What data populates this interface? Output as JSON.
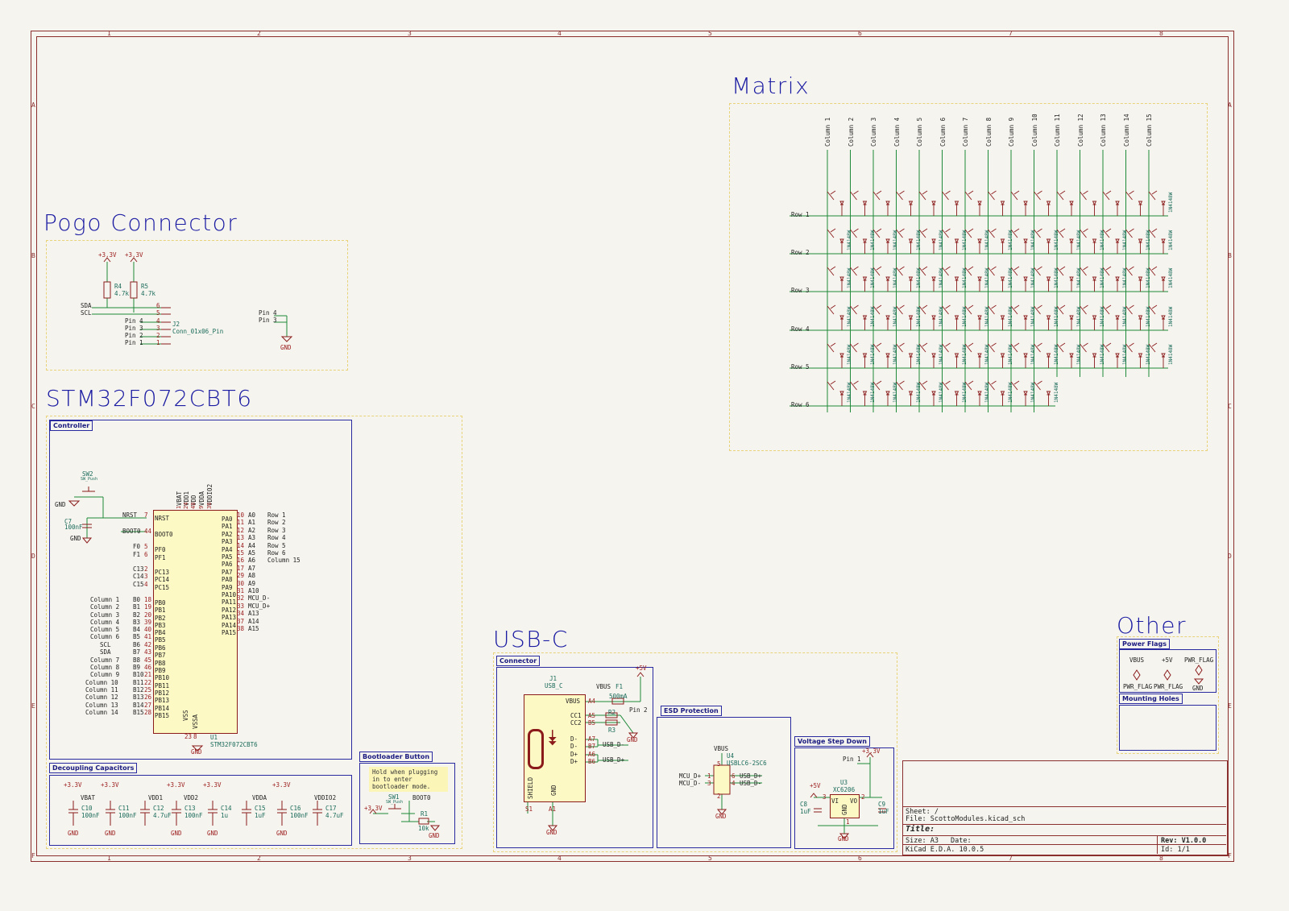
{
  "frame": {
    "zone_numbers": [
      "1",
      "2",
      "3",
      "4",
      "5",
      "6",
      "7",
      "8"
    ],
    "zone_letters": [
      "A",
      "B",
      "C",
      "D",
      "E",
      "F"
    ]
  },
  "sections": {
    "pogo": "Pogo Connector",
    "mcu": "STM32F072CBT6",
    "matrix": "Matrix",
    "usb": "USB-C",
    "other": "Other"
  },
  "boxes": {
    "controller": "Controller",
    "decoupling": "Decoupling Capacitors",
    "bootloader": "Bootloader Button",
    "connector": "Connector",
    "esd": "ESD Protection",
    "vreg": "Voltage Step Down",
    "power_flags": "Power Flags",
    "mounting_holes": "Mounting Holes"
  },
  "pogo": {
    "power1": "+3.3V",
    "power2": "+3.3V",
    "r4_ref": "R4",
    "r4_val": "4.7k",
    "r5_ref": "R5",
    "r5_val": "4.7k",
    "sda": "SDA",
    "scl": "SCL",
    "pins_left": [
      "Pin 4",
      "Pin 3",
      "Pin 2",
      "Pin 1"
    ],
    "pin_nums": [
      "6",
      "5",
      "4",
      "3",
      "2",
      "1"
    ],
    "j2_ref": "J2",
    "j2_val": "Conn_01x06_Pin",
    "pin4": "Pin 4",
    "pin3": "Pin 3",
    "gnd": "GND"
  },
  "mcu": {
    "sw2_ref": "SW2",
    "sw2_val": "SW_Push",
    "gnd1": "GND",
    "gnd2": "GND",
    "gnd3": "GND",
    "c7_ref": "C7",
    "c7_val": "100nF",
    "nrst": "NRST",
    "boot0": "BOOT0",
    "top_pins": [
      "VBAT",
      "VDD1",
      "VDD",
      "VDDA",
      "VDDIO2"
    ],
    "top_nums": [
      "1",
      "24",
      "48",
      "9",
      "36"
    ],
    "left_labels": [
      {
        "net": "NRST",
        "num": "7",
        "pin": "NRST"
      },
      {
        "net": "BOOT0",
        "num": "44",
        "pin": "BOOT0"
      },
      {
        "net": "F0",
        "num": "5",
        "pin": "PF0"
      },
      {
        "net": "F1",
        "num": "6",
        "pin": "PF1"
      },
      {
        "net": "C13",
        "num": "2",
        "pin": "PC13"
      },
      {
        "net": "C14",
        "num": "3",
        "pin": "PC14"
      },
      {
        "net": "C15",
        "num": "4",
        "pin": "PC15"
      },
      {
        "net": "B0",
        "num": "18",
        "pin": "PB0",
        "ext": "Column 1"
      },
      {
        "net": "B1",
        "num": "19",
        "pin": "PB1",
        "ext": "Column 2"
      },
      {
        "net": "B2",
        "num": "20",
        "pin": "PB2",
        "ext": "Column 3"
      },
      {
        "net": "B3",
        "num": "39",
        "pin": "PB3",
        "ext": "Column 4"
      },
      {
        "net": "B4",
        "num": "40",
        "pin": "PB4",
        "ext": "Column 5"
      },
      {
        "net": "B5",
        "num": "41",
        "pin": "PB5",
        "ext": "Column 6"
      },
      {
        "net": "B6",
        "num": "42",
        "pin": "PB6",
        "ext": "SCL"
      },
      {
        "net": "B7",
        "num": "43",
        "pin": "PB7",
        "ext": "SDA"
      },
      {
        "net": "B8",
        "num": "45",
        "pin": "PB8",
        "ext": "Column 7"
      },
      {
        "net": "B9",
        "num": "46",
        "pin": "PB9",
        "ext": "Column 8"
      },
      {
        "net": "B10",
        "num": "21",
        "pin": "PB10",
        "ext": "Column 9"
      },
      {
        "net": "B11",
        "num": "22",
        "pin": "PB11",
        "ext": "Column 10"
      },
      {
        "net": "B12",
        "num": "25",
        "pin": "PB12",
        "ext": "Column 11"
      },
      {
        "net": "B13",
        "num": "26",
        "pin": "PB13",
        "ext": "Column 12"
      },
      {
        "net": "B14",
        "num": "27",
        "pin": "PB14",
        "ext": "Column 13"
      },
      {
        "net": "B15",
        "num": "28",
        "pin": "PB15",
        "ext": "Column 14"
      }
    ],
    "right_labels": [
      {
        "pin": "PA0",
        "num": "10",
        "net": "A0",
        "ext": "Row 1"
      },
      {
        "pin": "PA1",
        "num": "11",
        "net": "A1",
        "ext": "Row 2"
      },
      {
        "pin": "PA2",
        "num": "12",
        "net": "A2",
        "ext": "Row 3"
      },
      {
        "pin": "PA3",
        "num": "13",
        "net": "A3",
        "ext": "Row 4"
      },
      {
        "pin": "PA4",
        "num": "14",
        "net": "A4",
        "ext": "Row 5"
      },
      {
        "pin": "PA5",
        "num": "15",
        "net": "A5",
        "ext": "Row 6"
      },
      {
        "pin": "PA6",
        "num": "16",
        "net": "A6",
        "ext": "Column 15"
      },
      {
        "pin": "PA7",
        "num": "17",
        "net": "A7",
        "ext": ""
      },
      {
        "pin": "PA8",
        "num": "29",
        "net": "A8",
        "ext": ""
      },
      {
        "pin": "PA9",
        "num": "30",
        "net": "A9",
        "ext": ""
      },
      {
        "pin": "PA10",
        "num": "31",
        "net": "A10",
        "ext": ""
      },
      {
        "pin": "PA11",
        "num": "32",
        "net": "MCU_D-",
        "ext": ""
      },
      {
        "pin": "PA12",
        "num": "33",
        "net": "MCU_D+",
        "ext": ""
      },
      {
        "pin": "PA13",
        "num": "34",
        "net": "A13",
        "ext": ""
      },
      {
        "pin": "PA14",
        "num": "37",
        "net": "A14",
        "ext": ""
      },
      {
        "pin": "PA15",
        "num": "38",
        "net": "A15",
        "ext": ""
      }
    ],
    "bottom_pins": [
      "VSS",
      "VSSA"
    ],
    "bottom_nums": [
      "23",
      "8"
    ],
    "u1_ref": "U1",
    "u1_val": "STM32F072CBT6"
  },
  "decoupling": {
    "rails": [
      "+3.3V",
      "+3.3V",
      "+3.3V",
      "+3.3V",
      "+3.3V"
    ],
    "nets": [
      "VBAT",
      "VDD1",
      "VDD2",
      "VDDA",
      "VDDIO2"
    ],
    "caps": [
      {
        "ref": "C10",
        "val": "100nF"
      },
      {
        "ref": "C11",
        "val": "100nF"
      },
      {
        "ref": "C12",
        "val": "4.7uF"
      },
      {
        "ref": "C13",
        "val": "100nF"
      },
      {
        "ref": "C14",
        "val": "1u"
      },
      {
        "ref": "C15",
        "val": "1uF"
      },
      {
        "ref": "C16",
        "val": "100nF"
      },
      {
        "ref": "C17",
        "val": "4.7uF"
      }
    ],
    "gnd": "GND"
  },
  "bootloader": {
    "note": "Hold when plugging in to enter bootloader mode.",
    "rail": "+3.3V",
    "sw1_ref": "SW1",
    "sw1_val": "SW_Push",
    "boot0": "BOOT0",
    "r1_ref": "R1",
    "r1_val": "10k",
    "gnd": "GND"
  },
  "usb": {
    "j1_ref": "J1",
    "j1_val": "USB_C",
    "vbus": "VBUS",
    "f1": "F1",
    "f1_val": "500mA",
    "plus5": "+5V",
    "pin2": "Pin 2",
    "pins": [
      "VBUS",
      "CC1",
      "CC2",
      "D-",
      "D-",
      "D+",
      "D+"
    ],
    "pin_nums": [
      "A4",
      "A5",
      "B5",
      "A7",
      "B7",
      "A6",
      "B6"
    ],
    "r2": "R2",
    "r3": "R3",
    "usb_dm": "USB_D-",
    "usb_dp": "USB_D+",
    "shield": "SHIELD",
    "gnd_pin": "GND",
    "s1": "S1",
    "a1": "A1",
    "gnd": "GND"
  },
  "esd": {
    "vbus": "VBUS",
    "u4_ref": "U4",
    "u4_val": "USBLC6-2SC6",
    "mcu_dp": "MCU_D+",
    "mcu_dm": "MCU_D-",
    "usb_dp": "USB_D+",
    "usb_dm": "USB_D-",
    "nums": [
      "1",
      "3",
      "6",
      "4",
      "5",
      "2"
    ],
    "gnd": "GND"
  },
  "vreg": {
    "pin1": "Pin 1",
    "rail33": "+3.3V",
    "rail5": "+5V",
    "u3_ref": "U3",
    "u3_val": "XC6206",
    "vi": "VI",
    "vo": "VO",
    "gnd_pin": "GND",
    "n3": "3",
    "n2": "2",
    "n1": "1",
    "c8_ref": "C8",
    "c8_val": "1uF",
    "c9_ref": "C9",
    "c9_val": "1uF",
    "gnd": "GND"
  },
  "matrix": {
    "columns": [
      "Column 1",
      "Column 2",
      "Column 3",
      "Column 4",
      "Column 5",
      "Column 6",
      "Column 7",
      "Column 8",
      "Column 9",
      "Column 10",
      "Column 11",
      "Column 12",
      "Column 13",
      "Column 14",
      "Column 15"
    ],
    "rows": [
      "Row 1",
      "Row 2",
      "Row 3",
      "Row 4",
      "Row 5",
      "Row 6"
    ],
    "diode_label": "1N4148W"
  },
  "other": {
    "vbus": "VBUS",
    "plus5": "+5V",
    "pwr_flag": "PWR_FLAG",
    "pwr_flag1": "PWR_FLAG",
    "pwr_flag2": "PWR_FLAG",
    "gnd": "GND"
  },
  "title_block": {
    "sheet": "Sheet: /",
    "file": "File: ScottoModules.kicad_sch",
    "title": "Title:",
    "size": "Size: A3",
    "date": "Date:",
    "rev": "Rev: V1.0.0",
    "tool": "KiCad E.D.A. 10.0.5",
    "id": "Id: 1/1"
  },
  "colors": {
    "frame": "#8b2e2e",
    "wire": "#1f8a3a",
    "box": "#2a2aa0",
    "title": "#1c1ca3",
    "ic_fill": "#fdf9c4",
    "pin": "#9b1b1b"
  }
}
